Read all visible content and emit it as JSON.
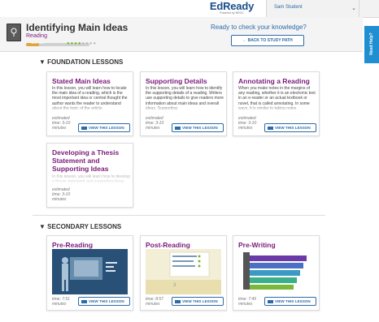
{
  "header": {
    "logo_main": "EdReady",
    "logo_sub": "Powered by NROC",
    "user_name": "Sam Student",
    "user_chevron": "chevron-down-icon"
  },
  "lesson": {
    "title": "Identifying Main Ideas",
    "subject": "Reading",
    "progress_label": "READY-READY",
    "progress_fraction": 0.2,
    "dots_filled": 4,
    "dots_total": 8,
    "ready_text": "Ready to check your knowledge?",
    "back_label": "← BACK TO STUDY PATH",
    "need_help": "Need Help?"
  },
  "sections": {
    "foundation_title": "▼ FOUNDATION LESSONS",
    "secondary_title": "▼ SECONDARY LESSONS"
  },
  "foundation": [
    {
      "title": "Stated Main Ideas",
      "desc": "In this lesson, you will learn how to locate the main idea of a reading, which is the most important idea or central thought the author wants the reader to understand about the topic of the article.",
      "time": "estimated time: 3-10 minutes",
      "btn": "VIEW THIS LESSON"
    },
    {
      "title": "Supporting Details",
      "desc": "In this lesson, you will learn how to identify the supporting details of a reading. Writers use supporting details to give readers more information about main ideas and overall ideas. Supporting",
      "time": "estimated time: 3-10 minutes",
      "btn": "VIEW THIS LESSON"
    },
    {
      "title": "Annotating a Reading",
      "desc": "When you make notes in the margins of any reading, whether it is an electronic text in an e-reader or an actual textbook or novel, that is called annotating. In some ways, it is similar to taking notes",
      "time": "estimated time: 3-10 minutes",
      "btn": "VIEW THIS LESSON"
    },
    {
      "title": "Developing a Thesis Statement and Supporting Ideas",
      "desc": "In this lesson, you will learn how to develop a thesis statement and supporting ideas.",
      "time": "estimated time: 3-10 minutes",
      "btn": ""
    }
  ],
  "secondary": [
    {
      "title": "Pre-Reading",
      "time": "time: 7:51 minutes",
      "btn": "VIEW THIS LESSON"
    },
    {
      "title": "Post-Reading",
      "time": "time: 8:57 minutes",
      "btn": "VIEW THIS LESSON"
    },
    {
      "title": "Pre-Writing",
      "time": "time: 7:49 minutes",
      "btn": "VIEW THIS LESSON"
    }
  ],
  "colors": {
    "accent_blue": "#2d6aa8",
    "title_purple": "#7a1a7a",
    "help_blue": "#1f8fd1",
    "progress_orange": "#e0a33e"
  }
}
